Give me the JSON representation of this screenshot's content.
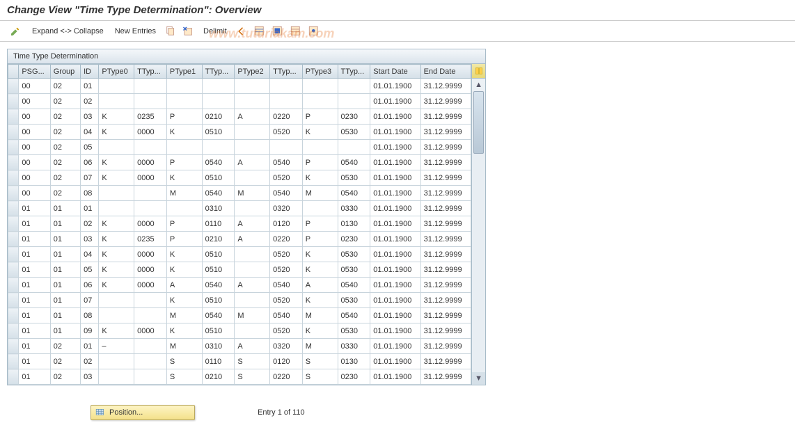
{
  "title": "Change View \"Time Type Determination\": Overview",
  "toolbar": {
    "expand_collapse": "Expand <-> Collapse",
    "new_entries": "New Entries",
    "delimit": "Delimit"
  },
  "watermark": "www.tuturiakam.com",
  "panel_title": "Time Type Determination",
  "columns": [
    "PSG...",
    "Group",
    "ID",
    "PType0",
    "TTyp...",
    "PType1",
    "TTyp...",
    "PType2",
    "TTyp...",
    "PType3",
    "TTyp...",
    "Start Date",
    "End Date"
  ],
  "rows": [
    {
      "psg": "00",
      "grp": "02",
      "id": "01",
      "p0": "",
      "t0": "",
      "p1": "",
      "t1": "",
      "p2": "",
      "t2": "",
      "p3": "",
      "t3": "",
      "sd": "01.01.1900",
      "ed": "31.12.9999"
    },
    {
      "psg": "00",
      "grp": "02",
      "id": "02",
      "p0": "",
      "t0": "",
      "p1": "",
      "t1": "",
      "p2": "",
      "t2": "",
      "p3": "",
      "t3": "",
      "sd": "01.01.1900",
      "ed": "31.12.9999"
    },
    {
      "psg": "00",
      "grp": "02",
      "id": "03",
      "p0": "K",
      "t0": "0235",
      "p1": "P",
      "t1": "0210",
      "p2": "A",
      "t2": "0220",
      "p3": "P",
      "t3": "0230",
      "sd": "01.01.1900",
      "ed": "31.12.9999"
    },
    {
      "psg": "00",
      "grp": "02",
      "id": "04",
      "p0": "K",
      "t0": "0000",
      "p1": "K",
      "t1": "0510",
      "p2": "",
      "t2": "0520",
      "p3": "K",
      "t3": "0530",
      "sd": "01.01.1900",
      "ed": "31.12.9999"
    },
    {
      "psg": "00",
      "grp": "02",
      "id": "05",
      "p0": "",
      "t0": "",
      "p1": "",
      "t1": "",
      "p2": "",
      "t2": "",
      "p3": "",
      "t3": "",
      "sd": "01.01.1900",
      "ed": "31.12.9999"
    },
    {
      "psg": "00",
      "grp": "02",
      "id": "06",
      "p0": "K",
      "t0": "0000",
      "p1": "P",
      "t1": "0540",
      "p2": "A",
      "t2": "0540",
      "p3": "P",
      "t3": "0540",
      "sd": "01.01.1900",
      "ed": "31.12.9999"
    },
    {
      "psg": "00",
      "grp": "02",
      "id": "07",
      "p0": "K",
      "t0": "0000",
      "p1": "K",
      "t1": "0510",
      "p2": "",
      "t2": "0520",
      "p3": "K",
      "t3": "0530",
      "sd": "01.01.1900",
      "ed": "31.12.9999"
    },
    {
      "psg": "00",
      "grp": "02",
      "id": "08",
      "p0": "",
      "t0": "",
      "p1": "M",
      "t1": "0540",
      "p2": "M",
      "t2": "0540",
      "p3": "M",
      "t3": "0540",
      "sd": "01.01.1900",
      "ed": "31.12.9999"
    },
    {
      "psg": "01",
      "grp": "01",
      "id": "01",
      "p0": "",
      "t0": "",
      "p1": "",
      "t1": "0310",
      "p2": "",
      "t2": "0320",
      "p3": "",
      "t3": "0330",
      "sd": "01.01.1900",
      "ed": "31.12.9999"
    },
    {
      "psg": "01",
      "grp": "01",
      "id": "02",
      "p0": "K",
      "t0": "0000",
      "p1": "P",
      "t1": "0110",
      "p2": "A",
      "t2": "0120",
      "p3": "P",
      "t3": "0130",
      "sd": "01.01.1900",
      "ed": "31.12.9999"
    },
    {
      "psg": "01",
      "grp": "01",
      "id": "03",
      "p0": "K",
      "t0": "0235",
      "p1": "P",
      "t1": "0210",
      "p2": "A",
      "t2": "0220",
      "p3": "P",
      "t3": "0230",
      "sd": "01.01.1900",
      "ed": "31.12.9999"
    },
    {
      "psg": "01",
      "grp": "01",
      "id": "04",
      "p0": "K",
      "t0": "0000",
      "p1": "K",
      "t1": "0510",
      "p2": "",
      "t2": "0520",
      "p3": "K",
      "t3": "0530",
      "sd": "01.01.1900",
      "ed": "31.12.9999"
    },
    {
      "psg": "01",
      "grp": "01",
      "id": "05",
      "p0": "K",
      "t0": "0000",
      "p1": "K",
      "t1": "0510",
      "p2": "",
      "t2": "0520",
      "p3": "K",
      "t3": "0530",
      "sd": "01.01.1900",
      "ed": "31.12.9999"
    },
    {
      "psg": "01",
      "grp": "01",
      "id": "06",
      "p0": "K",
      "t0": "0000",
      "p1": "A",
      "t1": "0540",
      "p2": "A",
      "t2": "0540",
      "p3": "A",
      "t3": "0540",
      "sd": "01.01.1900",
      "ed": "31.12.9999"
    },
    {
      "psg": "01",
      "grp": "01",
      "id": "07",
      "p0": "",
      "t0": "",
      "p1": "K",
      "t1": "0510",
      "p2": "",
      "t2": "0520",
      "p3": "K",
      "t3": "0530",
      "sd": "01.01.1900",
      "ed": "31.12.9999"
    },
    {
      "psg": "01",
      "grp": "01",
      "id": "08",
      "p0": "",
      "t0": "",
      "p1": "M",
      "t1": "0540",
      "p2": "M",
      "t2": "0540",
      "p3": "M",
      "t3": "0540",
      "sd": "01.01.1900",
      "ed": "31.12.9999"
    },
    {
      "psg": "01",
      "grp": "01",
      "id": "09",
      "p0": "K",
      "t0": "0000",
      "p1": "K",
      "t1": "0510",
      "p2": "",
      "t2": "0520",
      "p3": "K",
      "t3": "0530",
      "sd": "01.01.1900",
      "ed": "31.12.9999"
    },
    {
      "psg": "01",
      "grp": "02",
      "id": "01",
      "p0": "–",
      "t0": "",
      "p1": "M",
      "t1": "0310",
      "p2": "A",
      "t2": "0320",
      "p3": "M",
      "t3": "0330",
      "sd": "01.01.1900",
      "ed": "31.12.9999"
    },
    {
      "psg": "01",
      "grp": "02",
      "id": "02",
      "p0": "",
      "t0": "",
      "p1": "S",
      "t1": "0110",
      "p2": "S",
      "t2": "0120",
      "p3": "S",
      "t3": "0130",
      "sd": "01.01.1900",
      "ed": "31.12.9999"
    },
    {
      "psg": "01",
      "grp": "02",
      "id": "03",
      "p0": "",
      "t0": "",
      "p1": "S",
      "t1": "0210",
      "p2": "S",
      "t2": "0220",
      "p3": "S",
      "t3": "0230",
      "sd": "01.01.1900",
      "ed": "31.12.9999"
    }
  ],
  "position_btn": "Position...",
  "entry_text": "Entry 1 of 110"
}
